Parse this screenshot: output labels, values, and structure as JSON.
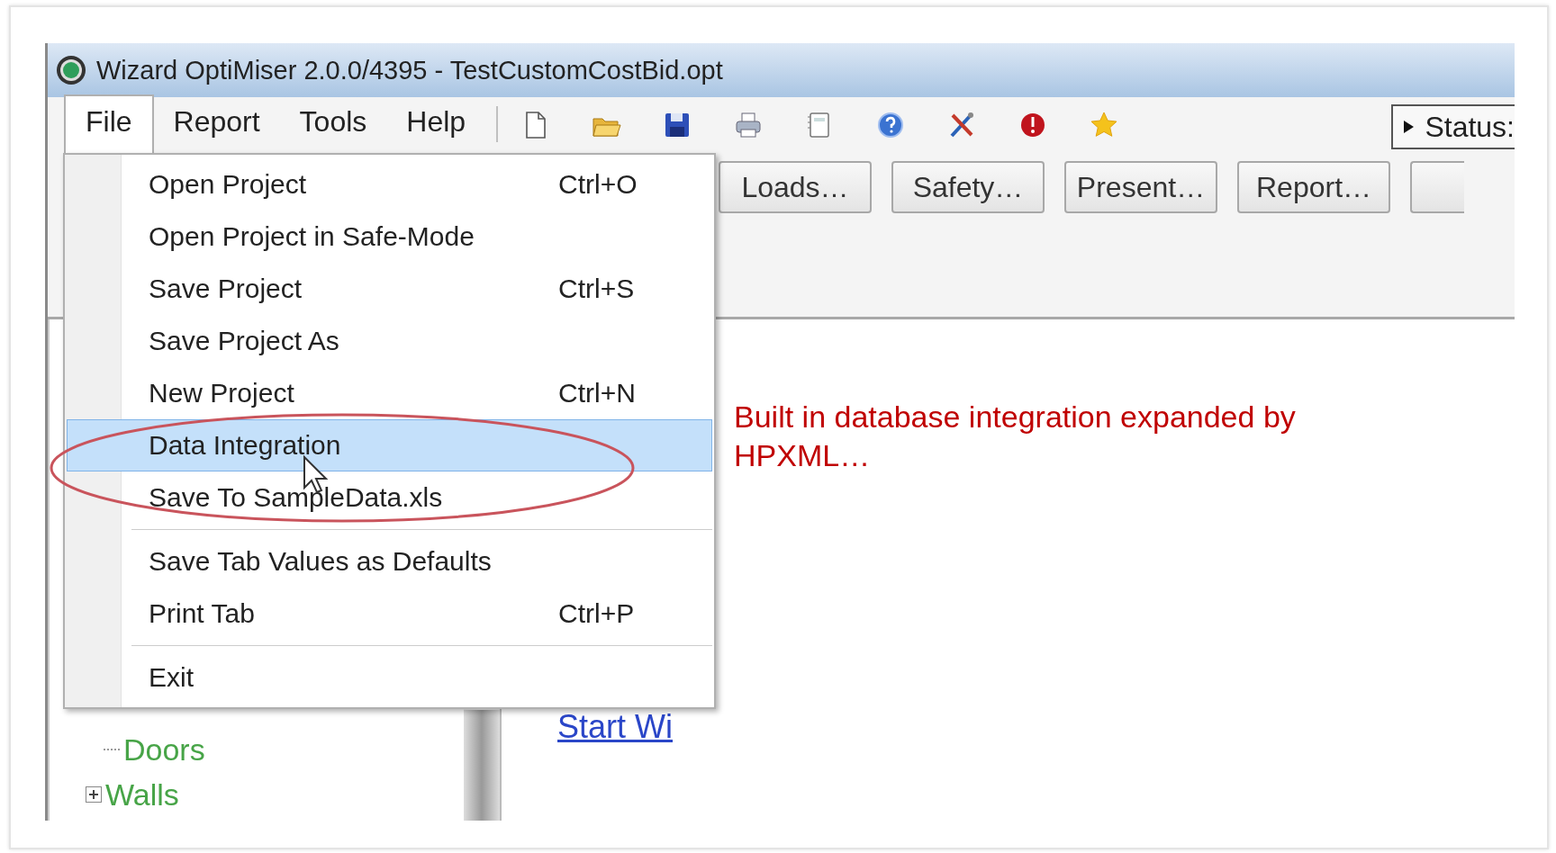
{
  "window": {
    "title": "Wizard OptiMiser 2.0.0/4395 - TestCustomCostBid.opt"
  },
  "menu_bar": [
    {
      "label": "File",
      "selected": true
    },
    {
      "label": "Report",
      "selected": false
    },
    {
      "label": "Tools",
      "selected": false
    },
    {
      "label": "Help",
      "selected": false
    }
  ],
  "status_button": {
    "label": "Status:"
  },
  "buttons": [
    "Loads…",
    "Safety…",
    "Present…",
    "Report…"
  ],
  "file_menu": [
    {
      "kind": "item",
      "label": "Open Project",
      "shortcut": "Ctrl+O",
      "selected": false
    },
    {
      "kind": "item",
      "label": "Open Project in Safe-Mode",
      "selected": false
    },
    {
      "kind": "item",
      "label": "Save Project",
      "shortcut": "Ctrl+S",
      "selected": false
    },
    {
      "kind": "item",
      "label": "Save Project As",
      "selected": false
    },
    {
      "kind": "item",
      "label": "New Project",
      "shortcut": "Ctrl+N",
      "selected": false
    },
    {
      "kind": "item",
      "label": "Data Integration",
      "selected": true
    },
    {
      "kind": "item",
      "label": "Save To SampleData.xls",
      "selected": false
    },
    {
      "kind": "separator"
    },
    {
      "kind": "item",
      "label": "Save Tab Values as Defaults",
      "selected": false
    },
    {
      "kind": "item",
      "label": "Print Tab",
      "shortcut": "Ctrl+P",
      "selected": false
    },
    {
      "kind": "separator"
    },
    {
      "kind": "item",
      "label": "Exit",
      "selected": false
    }
  ],
  "tree": [
    {
      "kind": "leaf",
      "label": "Doors"
    },
    {
      "kind": "branch",
      "label": "Walls"
    }
  ],
  "link": "Start Wi",
  "annotation": "Built in database integration expanded by HPXML…"
}
